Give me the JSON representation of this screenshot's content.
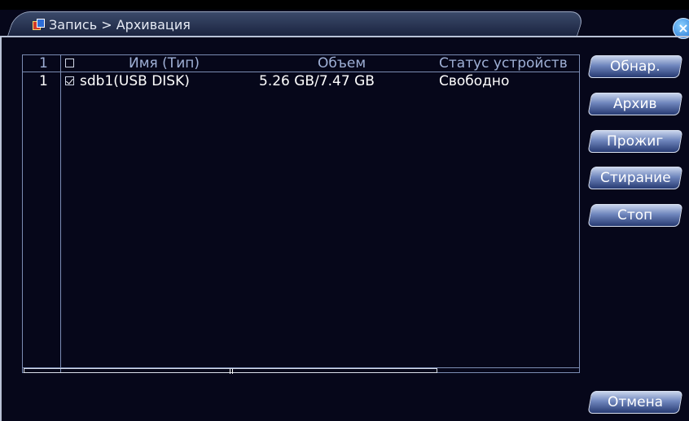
{
  "window": {
    "title": "Запись > Архивация",
    "close_symbol": "×"
  },
  "table": {
    "header": {
      "index": "1",
      "name": "Имя (Тип)",
      "size": "Объем",
      "status": "Статус устройств"
    },
    "rows": [
      {
        "index": "1",
        "checked": true,
        "name": "sdb1(USB DISK)",
        "size": "5.26 GB/7.47 GB",
        "status": "Свободно"
      }
    ],
    "scroll_position": 0
  },
  "buttons": {
    "detect": "Обнар.",
    "archive": "Архив",
    "burn": "Прожиг",
    "erase": "Стирание",
    "stop": "Стоп",
    "cancel": "Отмена"
  },
  "colors": {
    "background": "#06071a",
    "header_text": "#9fb0d6",
    "row_text": "#ffffff",
    "button_top": "#c8d4ec",
    "button_bottom": "#283b73"
  }
}
